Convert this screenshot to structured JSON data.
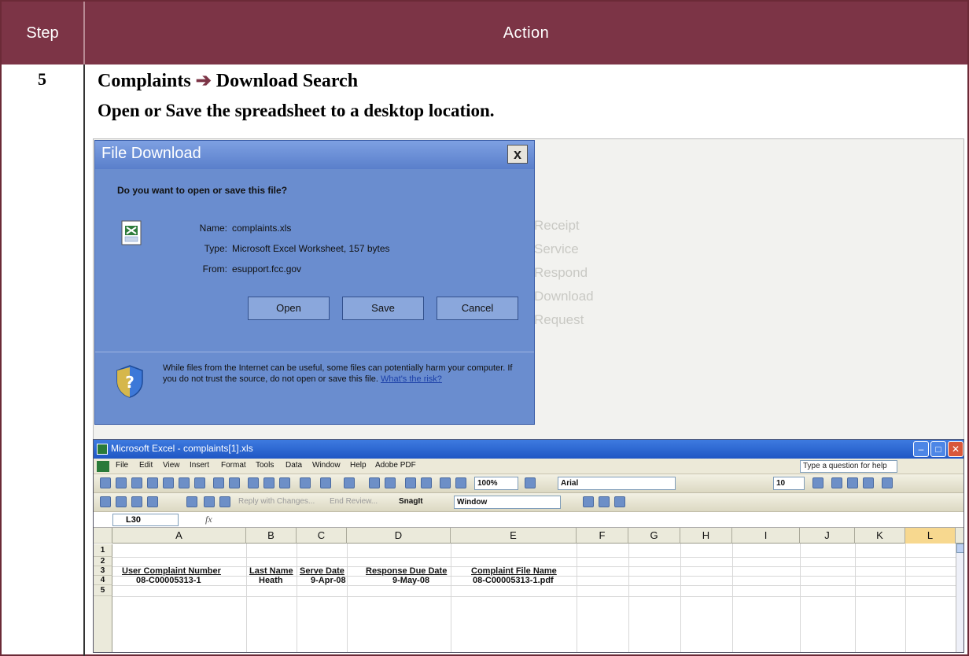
{
  "table": {
    "header": {
      "step": "Step",
      "action": "Action"
    },
    "row": {
      "step_number": "5",
      "title_part1": "Complaints",
      "title_arrow": "➔",
      "title_part2": "Download Search",
      "subtitle": "Open or Save the spreadsheet to a desktop location."
    }
  },
  "dialog": {
    "title": "File Download",
    "close_label": "x",
    "question": "Do you want to open or save this file?",
    "name_label": "Name:",
    "name_value": "complaints.xls",
    "type_label": "Type:",
    "type_value": "Microsoft Excel Worksheet, 157 bytes",
    "from_label": "From:",
    "from_value": "esupport.fcc.gov",
    "buttons": {
      "open": "Open",
      "save": "Save",
      "cancel": "Cancel"
    },
    "warning_text": "While files from the Internet can be useful, some files can potentially harm your computer. If you do not trust the source, do not open or save this file.",
    "warning_link": "What's the risk?"
  },
  "background_text": [
    "Receipt",
    "Service",
    "Respond",
    "Download",
    "Request"
  ],
  "excel": {
    "title": "Microsoft Excel - complaints[1].xls",
    "menu": [
      "File",
      "Edit",
      "View",
      "Insert",
      "Format",
      "Tools",
      "Data",
      "Window",
      "Help",
      "Adobe PDF"
    ],
    "help_placeholder": "Type a question for help",
    "zoom": "100%",
    "font_name": "Arial",
    "font_size": "10",
    "reply_text": "Reply with Changes...",
    "end_review": "End Review...",
    "snagit": "SnagIt",
    "window_label": "Window",
    "name_box": "L30",
    "fx": "fx",
    "columns": [
      "A",
      "B",
      "C",
      "D",
      "E",
      "F",
      "G",
      "H",
      "I",
      "J",
      "K",
      "L"
    ],
    "rows": [
      "1",
      "2",
      "3",
      "4",
      "5"
    ],
    "headers_row3": [
      "User Complaint Number",
      "Last Name",
      "Serve Date",
      "Response Due Date",
      "Complaint File Name"
    ],
    "data_row4": [
      "08-C00005313-1",
      "Heath",
      "9-Apr-08",
      "9-May-08",
      "08-C00005313-1.pdf"
    ]
  }
}
